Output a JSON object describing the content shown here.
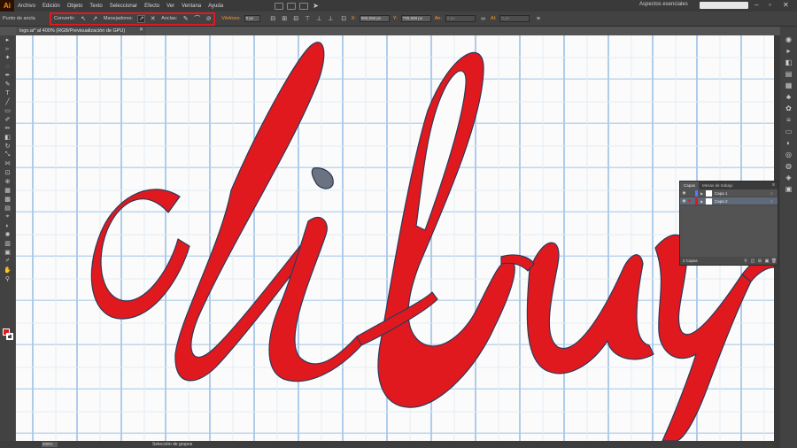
{
  "app": {
    "logo": "Ai"
  },
  "menu": [
    "Archivo",
    "Edición",
    "Objeto",
    "Texto",
    "Seleccionar",
    "Efecto",
    "Ver",
    "Ventana",
    "Ayuda"
  ],
  "workspace": "Aspectos esenciales",
  "control": {
    "anchor_label": "Punto de ancla",
    "convert_label": "Convertir:",
    "handles_label": "Manejadores:",
    "anchors_label": "Anclas:",
    "vertices_label": "Vértices:",
    "vertices_value": "0 px",
    "x_label": "X:",
    "x_value": "965,056 px",
    "y_label": "Y:",
    "y_value": "785,568 px",
    "w_label": "An:",
    "w_value": "0 px",
    "h_label": "Al:",
    "h_value": "0 px"
  },
  "document": {
    "tab_title": "logo.ai* al 400% (RGB/Previsualización de GPU)"
  },
  "status": {
    "zoom": "400%",
    "text": "Selección de grupos"
  },
  "layers_panel": {
    "tabs": [
      "Capas",
      "Mesas de trabajo"
    ],
    "layers": [
      {
        "name": "Capa 1",
        "color": "#4f7cff",
        "selected": false
      },
      {
        "name": "Capa 2",
        "color": "#e0191f",
        "selected": true
      }
    ],
    "footer": "2 Capas"
  },
  "colors": {
    "fill": "#e0191f",
    "accent": "#ff9a2e",
    "highlight": "#e0191f"
  }
}
